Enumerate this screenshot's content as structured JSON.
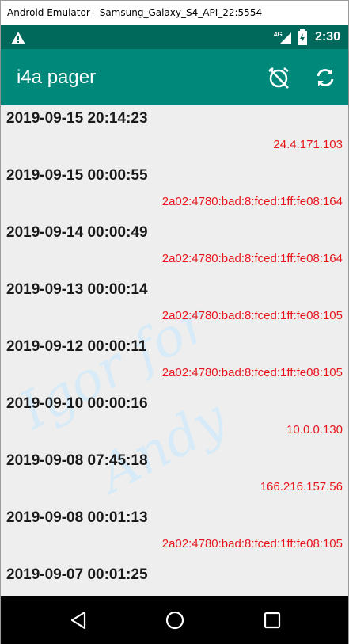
{
  "window": {
    "title": "Android Emulator - Samsung_Galaxy_S4_API_22:5554"
  },
  "status_bar": {
    "time": "2:30",
    "network_label": "4G",
    "icons": [
      "warning-icon",
      "signal-icon",
      "battery-icon"
    ]
  },
  "app_bar": {
    "title": "i4a pager",
    "actions": [
      "alarm-off-icon",
      "refresh-icon"
    ]
  },
  "entries": [
    {
      "date": "2019-09-15 20:14:23",
      "ip": "24.4.171.103"
    },
    {
      "date": "2019-09-15 00:00:55",
      "ip": "2a02:4780:bad:8:fced:1ff:fe08:164"
    },
    {
      "date": "2019-09-14 00:00:49",
      "ip": "2a02:4780:bad:8:fced:1ff:fe08:164"
    },
    {
      "date": "2019-09-13 00:00:14",
      "ip": "2a02:4780:bad:8:fced:1ff:fe08:105"
    },
    {
      "date": "2019-09-12 00:00:11",
      "ip": "2a02:4780:bad:8:fced:1ff:fe08:105"
    },
    {
      "date": "2019-09-10 00:00:16",
      "ip": "10.0.0.130"
    },
    {
      "date": "2019-09-08 07:45:18",
      "ip": "166.216.157.56"
    },
    {
      "date": "2019-09-08 00:01:13",
      "ip": "2a02:4780:bad:8:fced:1ff:fe08:105"
    },
    {
      "date": "2019-09-07 00:01:25",
      "ip": ""
    }
  ],
  "watermark": {
    "line1": "Igor for",
    "line2": "Andy"
  },
  "nav_bar": {
    "buttons": [
      "back-icon",
      "home-icon",
      "recents-icon"
    ]
  },
  "colors": {
    "status_bar": "#00695c",
    "app_bar": "#00897b",
    "ip_text": "#e8161b",
    "list_background": "#eeeeee",
    "watermark": "#cfe6f5"
  }
}
